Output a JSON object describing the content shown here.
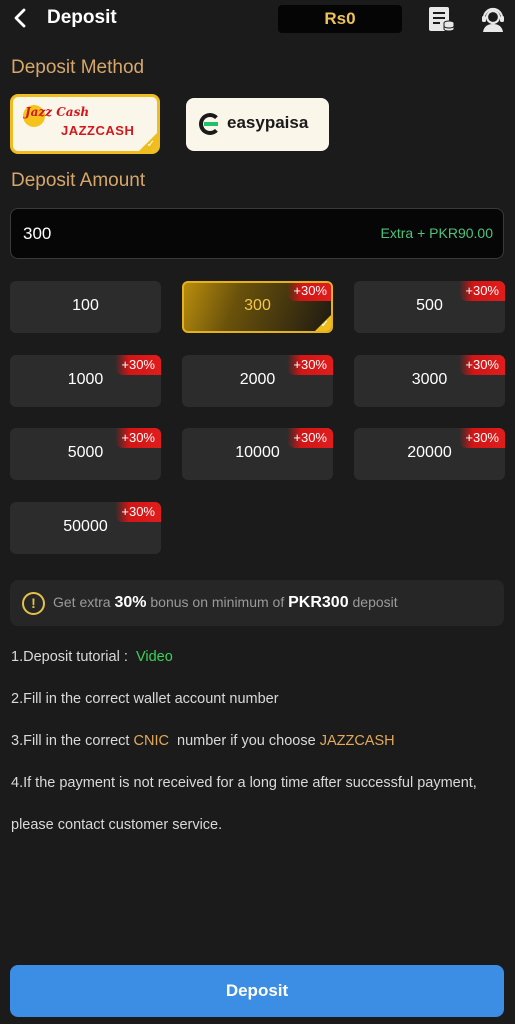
{
  "header": {
    "title": "Deposit",
    "balance": "Rs0"
  },
  "method_section": {
    "label": "Deposit Method",
    "methods": [
      {
        "name": "JazzCash",
        "brand_small": "Jazz Cash",
        "brand_text": "JAZZCASH",
        "selected": true
      },
      {
        "name": "easypaisa",
        "brand_text": "easypaisa",
        "selected": false
      }
    ]
  },
  "amount_section": {
    "label": "Deposit Amount",
    "value": "300",
    "extra": "Extra + PKR90.00"
  },
  "amount_options": [
    {
      "value": "100",
      "badge": ""
    },
    {
      "value": "300",
      "badge": "+30%",
      "selected": true
    },
    {
      "value": "500",
      "badge": "+30%"
    },
    {
      "value": "1000",
      "badge": "+30%"
    },
    {
      "value": "2000",
      "badge": "+30%"
    },
    {
      "value": "3000",
      "badge": "+30%"
    },
    {
      "value": "5000",
      "badge": "+30%"
    },
    {
      "value": "10000",
      "badge": "+30%"
    },
    {
      "value": "20000",
      "badge": "+30%"
    },
    {
      "value": "50000",
      "badge": "+30%"
    }
  ],
  "bonus": {
    "icon": "!",
    "prefix": "Get extra ",
    "percent": "30%",
    "middle": " bonus on minimum of ",
    "amount": "PKR300",
    "suffix": " deposit"
  },
  "instructions": {
    "line1_prefix": "1.Deposit tutorial :",
    "line1_link": "Video",
    "line2": "2.Fill in the correct wallet account number",
    "line3_prefix": "3.Fill in the correct ",
    "line3_cnic": "CNIC",
    "line3_middle": "  number if you choose ",
    "line3_method": "JAZZCASH",
    "line4": "4.If the payment is not received for a long time after successful payment,",
    "line5": "please contact customer service."
  },
  "deposit_button": "Deposit",
  "colors": {
    "background": "#1b1b1b",
    "gold": "#d6a769",
    "accent_blue": "#3c8de4",
    "green": "#39d159",
    "badge_red": "#d21515"
  }
}
